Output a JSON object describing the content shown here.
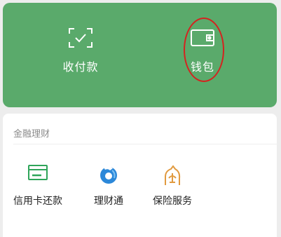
{
  "top_actions": [
    {
      "label": "收付款",
      "icon": "scan-pay-icon"
    },
    {
      "label": "钱包",
      "icon": "wallet-icon"
    }
  ],
  "finance": {
    "title": "金融理财",
    "items": [
      {
        "label": "信用卡还款",
        "icon": "credit-card-icon"
      },
      {
        "label": "理财通",
        "icon": "licaitong-icon"
      },
      {
        "label": "保险服务",
        "icon": "insurance-icon"
      }
    ]
  },
  "colors": {
    "top_card": "#5aaa6b",
    "annotation": "#d4231f",
    "credit_green": "#2fa55a",
    "licaitong_blue": "#2c88d9",
    "insurance_orange": "#e19a3f"
  }
}
